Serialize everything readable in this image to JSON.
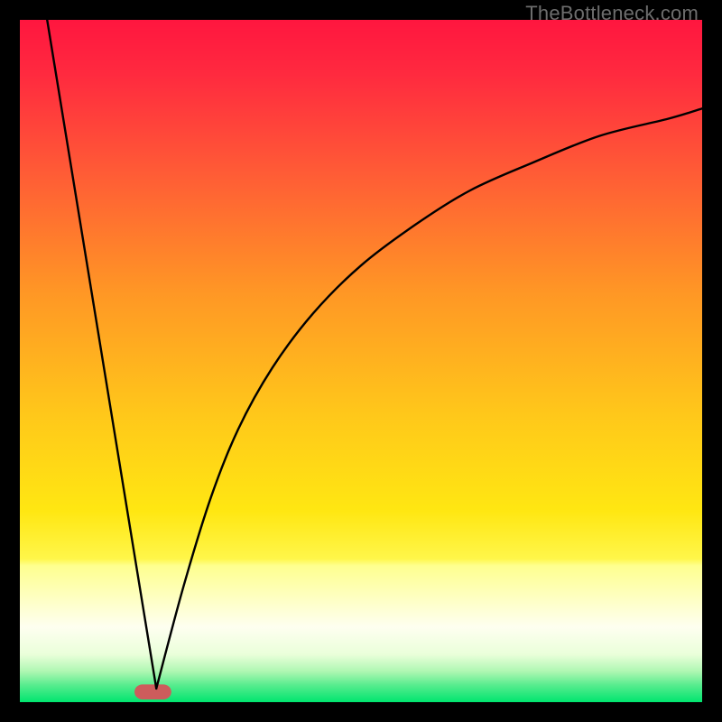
{
  "watermark": "TheBottleneck.com",
  "chart_data": {
    "type": "line",
    "title": "",
    "xlabel": "",
    "ylabel": "",
    "xlim": [
      0,
      100
    ],
    "ylim": [
      0,
      100
    ],
    "grid": false,
    "legend": false,
    "gradient_bands": [
      {
        "start": "#ff1744",
        "end": "#ff9100",
        "from": 100,
        "to": 60
      },
      {
        "start": "#ff9100",
        "end": "#ffeb3b",
        "from": 60,
        "to": 28
      },
      {
        "start": "#ffeb3b",
        "end": "#fff176",
        "from": 28,
        "to": 20
      },
      {
        "start": "#fff176",
        "end": "#fefff1",
        "from": 20,
        "to": 7
      },
      {
        "start": "#e7ffdb",
        "end": "#00e676",
        "from": 7,
        "to": 0
      }
    ],
    "series": [
      {
        "name": "left-limb",
        "x": [
          4,
          20
        ],
        "y": [
          100,
          2
        ],
        "style": "straight-line"
      },
      {
        "name": "right-limb",
        "x": [
          20,
          24,
          28,
          32,
          37,
          43,
          50,
          58,
          66,
          75,
          85,
          95,
          100
        ],
        "y": [
          2,
          17,
          30,
          40,
          49,
          57,
          64,
          70,
          75,
          79,
          83,
          85.5,
          87
        ],
        "style": "curve"
      }
    ],
    "marker": {
      "name": "optimum-marker",
      "x": 19.5,
      "y": 1.5,
      "width": 5.4,
      "height": 2.2,
      "color": "#cd5c5c"
    }
  }
}
